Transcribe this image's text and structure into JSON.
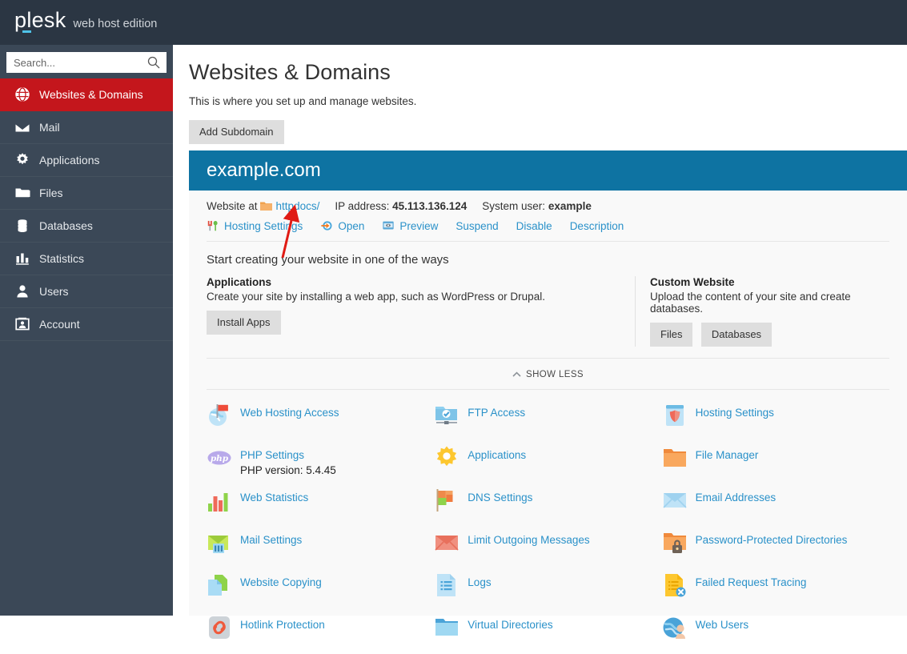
{
  "topbar": {
    "logo_text": "plesk",
    "edition": "web host edition"
  },
  "sidebar": {
    "search": {
      "placeholder": "Search...",
      "value": "",
      "icon": "search-icon"
    },
    "items": [
      {
        "label": "Websites & Domains",
        "icon": "globe-icon",
        "active": true
      },
      {
        "label": "Mail",
        "icon": "envelope-icon",
        "active": false
      },
      {
        "label": "Applications",
        "icon": "gear-icon",
        "active": false
      },
      {
        "label": "Files",
        "icon": "folder-icon",
        "active": false
      },
      {
        "label": "Databases",
        "icon": "database-icon",
        "active": false
      },
      {
        "label": "Statistics",
        "icon": "bar-chart-icon",
        "active": false
      },
      {
        "label": "Users",
        "icon": "user-icon",
        "active": false
      },
      {
        "label": "Account",
        "icon": "id-card-icon",
        "active": false
      }
    ]
  },
  "page": {
    "title": "Websites & Domains",
    "subtitle": "This is where you set up and manage websites.",
    "add_subdomain_label": "Add Subdomain"
  },
  "domain": {
    "name": "example.com",
    "website_at_label": "Website at",
    "docroot": "httpdocs/",
    "ip_label": "IP address:",
    "ip_value": "45.113.136.124",
    "sysuser_label": "System user:",
    "sysuser_value": "example",
    "actions": [
      {
        "label": "Hosting Settings",
        "icon": "tools-icon"
      },
      {
        "label": "Open",
        "icon": "open-arrow-icon"
      },
      {
        "label": "Preview",
        "icon": "preview-icon"
      },
      {
        "label": "Suspend",
        "icon": ""
      },
      {
        "label": "Disable",
        "icon": ""
      },
      {
        "label": "Description",
        "icon": ""
      }
    ]
  },
  "ways": {
    "heading": "Start creating your website in one of the ways",
    "applications": {
      "title": "Applications",
      "desc": "Create your site by installing a web app, such as WordPress or Drupal.",
      "buttons": [
        "Install Apps"
      ]
    },
    "custom": {
      "title": "Custom Website",
      "desc": "Upload the content of your site and create databases.",
      "buttons": [
        "Files",
        "Databases"
      ]
    }
  },
  "show_less": {
    "label": "SHOW LESS",
    "icon": "chevron-up-icon"
  },
  "features": {
    "columns": [
      [
        {
          "label": "Web Hosting Access",
          "icon": "globe-flag-icon",
          "sub": ""
        },
        {
          "label": "PHP Settings",
          "icon": "php-icon",
          "sub": "PHP version: 5.4.45"
        },
        {
          "label": "Web Statistics",
          "icon": "bar-chart-color-icon",
          "sub": ""
        },
        {
          "label": "Mail Settings",
          "icon": "mail-settings-icon",
          "sub": ""
        },
        {
          "label": "Website Copying",
          "icon": "copy-pages-icon",
          "sub": ""
        },
        {
          "label": "Hotlink Protection",
          "icon": "chain-link-icon",
          "sub": ""
        }
      ],
      [
        {
          "label": "FTP Access",
          "icon": "ftp-folder-icon",
          "sub": ""
        },
        {
          "label": "Applications",
          "icon": "gear-yellow-icon",
          "sub": ""
        },
        {
          "label": "DNS Settings",
          "icon": "flags-icon",
          "sub": ""
        },
        {
          "label": "Limit Outgoing Messages",
          "icon": "envelope-red-icon",
          "sub": ""
        },
        {
          "label": "Logs",
          "icon": "document-lines-icon",
          "sub": ""
        },
        {
          "label": "Virtual Directories",
          "icon": "folder-blue-icon",
          "sub": ""
        }
      ],
      [
        {
          "label": "Hosting Settings",
          "icon": "shield-panel-icon",
          "sub": ""
        },
        {
          "label": "File Manager",
          "icon": "folder-orange-icon",
          "sub": ""
        },
        {
          "label": "Email Addresses",
          "icon": "envelope-blue-icon",
          "sub": ""
        },
        {
          "label": "Password-Protected Directories",
          "icon": "folder-lock-icon",
          "sub": ""
        },
        {
          "label": "Failed Request Tracing",
          "icon": "document-error-icon",
          "sub": ""
        },
        {
          "label": "Web Users",
          "icon": "globe-user-icon",
          "sub": ""
        }
      ]
    ]
  },
  "colors": {
    "topbar": "#2b3643",
    "sidebar": "#3b4857",
    "active_item": "#c4161c",
    "domain_header": "#0e73a2",
    "link": "#2a91c9",
    "annotation_arrow": "#e01b14"
  }
}
